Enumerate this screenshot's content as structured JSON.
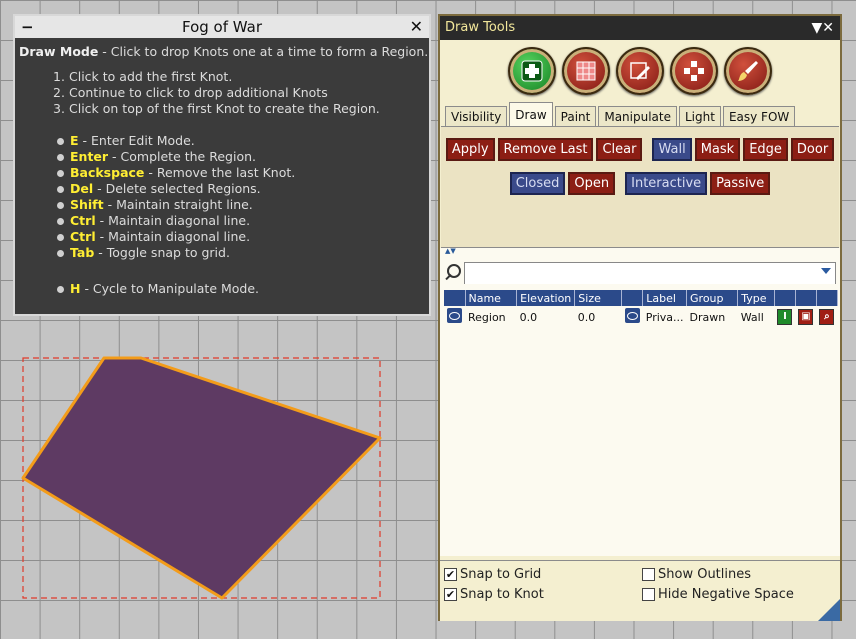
{
  "fog_panel": {
    "title": "Fog of War",
    "minimize_glyph": "−",
    "close_glyph": "✕",
    "intro_label": "Draw Mode",
    "intro_text": " - Click to drop Knots one at a time to form a Region.",
    "steps": [
      {
        "num": "1.",
        "text": "Click to add the first Knot."
      },
      {
        "num": "2.",
        "text": "Continue to click to drop additional Knots"
      },
      {
        "num": "3.",
        "text": "Click on top of the first Knot to create the Region."
      }
    ],
    "shortcuts": [
      {
        "key": "E",
        "text": " - Enter Edit Mode."
      },
      {
        "key": "Enter",
        "text": " - Complete the Region."
      },
      {
        "key": "Backspace",
        "text": " - Remove the last Knot."
      },
      {
        "key": "Del",
        "text": " - Delete selected Regions."
      },
      {
        "key": "Shift",
        "text": " - Maintain straight line."
      },
      {
        "key": "Ctrl",
        "text": " - Maintain diagonal line."
      },
      {
        "key": "Ctrl",
        "text": " - Maintain diagonal line."
      },
      {
        "key": "Tab",
        "text": " - Toggle snap to grid."
      },
      {
        "key": "H",
        "text": " - Cycle to Manipulate Mode."
      }
    ]
  },
  "draw_panel": {
    "title": "Draw Tools",
    "controls_glyph": "▼✕",
    "tool_icons": [
      {
        "name": "add-region-icon",
        "style": "green"
      },
      {
        "name": "paint-grid-icon",
        "style": "red"
      },
      {
        "name": "edit-draw-icon",
        "style": "red"
      },
      {
        "name": "scatter-grid-icon",
        "style": "red"
      },
      {
        "name": "brush-icon",
        "style": "red"
      }
    ],
    "tabs": [
      "Visibility",
      "Draw",
      "Paint",
      "Manipulate",
      "Light",
      "Easy FOW"
    ],
    "active_tab": "Draw",
    "row1_buttons": [
      {
        "label": "Apply",
        "style": "red"
      },
      {
        "label": "Remove Last",
        "style": "red"
      },
      {
        "label": "Clear",
        "style": "red"
      },
      {
        "label": "Wall",
        "style": "blue"
      },
      {
        "label": "Mask",
        "style": "red"
      },
      {
        "label": "Edge",
        "style": "red"
      },
      {
        "label": "Door",
        "style": "red"
      }
    ],
    "row2_buttons": [
      {
        "label": "Closed",
        "style": "blue"
      },
      {
        "label": "Open",
        "style": "red"
      },
      {
        "label": "Interactive",
        "style": "blue"
      },
      {
        "label": "Passive",
        "style": "red"
      }
    ],
    "search": {
      "value": "",
      "placeholder": ""
    },
    "table": {
      "columns": [
        "",
        "Name",
        "Elevation",
        "Size",
        "",
        "Label",
        "Group",
        "Type",
        "",
        "",
        ""
      ],
      "rows": [
        {
          "name": "Region",
          "elevation": "0.0",
          "size": "0.0",
          "label": "Priva...",
          "group": "Drawn",
          "type": "Wall"
        }
      ]
    },
    "options": {
      "snap_grid": {
        "label": "Snap to Grid",
        "checked": true
      },
      "snap_knot": {
        "label": "Snap to Knot",
        "checked": true
      },
      "show_outlines": {
        "label": "Show Outlines",
        "checked": false
      },
      "hide_negative": {
        "label": "Hide Negative Space",
        "checked": false
      }
    }
  },
  "colors": {
    "region_fill": "#5e3a63",
    "region_stroke": "#f39c1a",
    "selection_dash": "#e03a2a",
    "panel_bg": "#f4efd0",
    "button_red": "#8c1e14",
    "button_blue": "#3a4a8a"
  }
}
